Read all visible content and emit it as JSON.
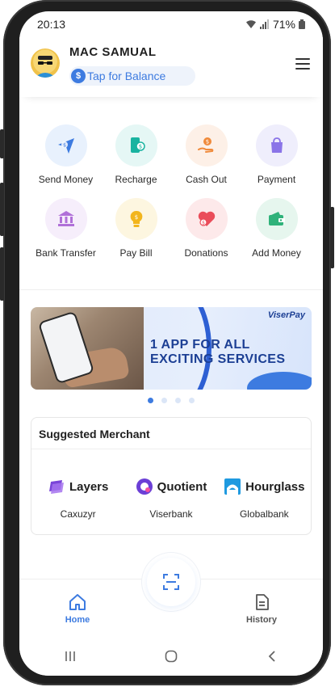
{
  "status_bar": {
    "time": "20:13",
    "battery": "71%"
  },
  "header": {
    "user_name": "MAC SAMUAL",
    "balance_label": "Tap for Balance",
    "balance_coin": "$"
  },
  "services": [
    {
      "label": "Send Money",
      "icon": "send-money-icon",
      "bg": "#e8f1fd",
      "color": "#3d7be0"
    },
    {
      "label": "Recharge",
      "icon": "recharge-icon",
      "bg": "#e5f7f5",
      "color": "#19b3a0"
    },
    {
      "label": "Cash Out",
      "icon": "cash-out-icon",
      "bg": "#fdf0e7",
      "color": "#f08a3a"
    },
    {
      "label": "Payment",
      "icon": "payment-icon",
      "bg": "#efeefc",
      "color": "#8a74e8"
    },
    {
      "label": "Bank Transfer",
      "icon": "bank-icon",
      "bg": "#f6eefb",
      "color": "#b070d8"
    },
    {
      "label": "Pay Bill",
      "icon": "pay-bill-icon",
      "bg": "#fdf6e0",
      "color": "#f2b51d"
    },
    {
      "label": "Donations",
      "icon": "donation-icon",
      "bg": "#fde9ea",
      "color": "#ea4d5a"
    },
    {
      "label": "Add Money",
      "icon": "add-money-icon",
      "bg": "#e6f6ee",
      "color": "#2fb27a"
    }
  ],
  "banner": {
    "brand": "ViserPay",
    "headline_line1": "1 APP FOR ALL",
    "headline_line2": "EXCITING SERVICES",
    "slides": 4,
    "active_slide": 1
  },
  "suggested_merchant": {
    "title": "Suggested Merchant",
    "merchants": [
      {
        "logo_text": "Layers",
        "name": "Caxuzyr"
      },
      {
        "logo_text": "Quotient",
        "name": "Viserbank"
      },
      {
        "logo_text": "Hourglass",
        "name": "Globalbank"
      }
    ]
  },
  "bottom_nav": {
    "home_label": "Home",
    "history_label": "History",
    "active": "Home",
    "accent": "#3d7be0",
    "inactive": "#555555"
  }
}
